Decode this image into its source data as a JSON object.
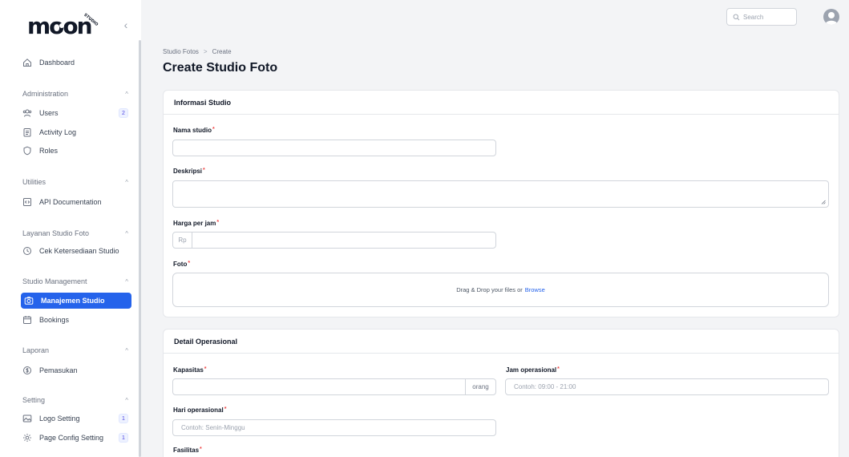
{
  "sidebar": {
    "logo_text": "moon",
    "logo_small": "STUDIO",
    "dashboard": "Dashboard",
    "groups": {
      "administration": "Administration",
      "utilities": "Utilities",
      "layanan": "Layanan Studio Foto",
      "studio_management": "Studio Management",
      "laporan": "Laporan",
      "setting": "Setting"
    },
    "items": {
      "users": "Users",
      "users_badge": "2",
      "activity_log": "Activity Log",
      "roles": "Roles",
      "api_docs": "API Documentation",
      "cek_ketersediaan": "Cek Ketersediaan Studio",
      "manajemen_studio": "Manajemen Studio",
      "bookings": "Bookings",
      "pemasukan": "Pemasukan",
      "logo_setting": "Logo Setting",
      "logo_setting_badge": "1",
      "page_config": "Page Config Setting",
      "page_config_badge": "1"
    }
  },
  "topbar": {
    "search_placeholder": "Search"
  },
  "breadcrumb": {
    "parent": "Studio Fotos",
    "separator": ">",
    "current": "Create"
  },
  "page_title": "Create Studio Foto",
  "sections": {
    "info": {
      "title": "Informasi Studio",
      "nama_label": "Nama studio",
      "deskripsi_label": "Deskripsi",
      "harga_label": "Harga per jam",
      "harga_prefix": "Rp",
      "foto_label": "Foto",
      "dropzone_text": "Drag & Drop your files or",
      "dropzone_browse": "Browse"
    },
    "operasional": {
      "title": "Detail Operasional",
      "kapasitas_label": "Kapasitas",
      "kapasitas_suffix": "orang",
      "jam_label": "Jam operasional",
      "jam_placeholder": "Contoh: 09:00 - 21:00",
      "hari_label": "Hari operasional",
      "hari_placeholder": "Contoh: Senin-Minggu",
      "fasilitas_label": "Fasilitas"
    }
  },
  "required_mark": "*",
  "colors": {
    "accent": "#2563eb",
    "required": "#ef4444"
  }
}
